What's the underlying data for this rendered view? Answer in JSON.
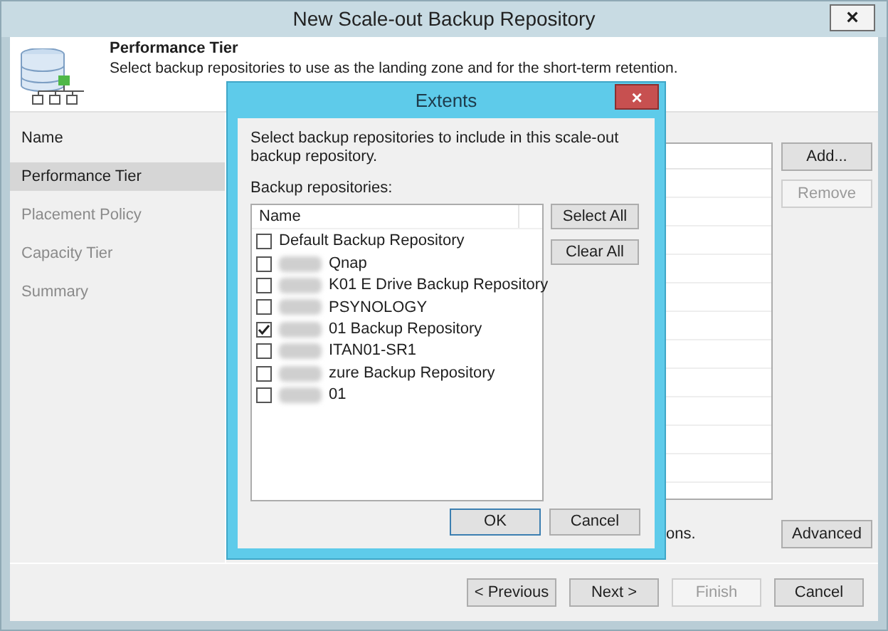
{
  "window": {
    "title": "New Scale-out Backup Repository",
    "close": "×"
  },
  "header": {
    "title": "Performance Tier",
    "subtitle": "Select backup repositories to use as the landing zone and for the short-term retention."
  },
  "steps": [
    {
      "label": "Name",
      "selected": false,
      "disabled": false
    },
    {
      "label": "Performance Tier",
      "selected": true,
      "disabled": false
    },
    {
      "label": "Placement Policy",
      "selected": false,
      "disabled": true
    },
    {
      "label": "Capacity Tier",
      "selected": false,
      "disabled": true
    },
    {
      "label": "Summary",
      "selected": false,
      "disabled": true
    }
  ],
  "side_buttons": [
    {
      "label": "Add...",
      "disabled": false
    },
    {
      "label": "Remove",
      "disabled": true
    }
  ],
  "hint_fragment": "ons.",
  "advanced_button": "Advanced",
  "footer_buttons": [
    {
      "label": "< Previous",
      "disabled": false
    },
    {
      "label": "Next >",
      "disabled": false
    },
    {
      "label": "Finish",
      "disabled": true
    },
    {
      "label": "Cancel",
      "disabled": false
    }
  ],
  "dialog": {
    "title": "Extents",
    "close": "×",
    "instruction": "Select backup repositories to include in this scale-out backup repository.",
    "list_label": "Backup repositories:",
    "column": "Name",
    "items": [
      {
        "label": "Default Backup Repository",
        "checked": false,
        "redacted": false
      },
      {
        "label": "Qnap",
        "checked": false,
        "redacted": true
      },
      {
        "label": "K01 E Drive Backup Repository",
        "checked": false,
        "redacted": true
      },
      {
        "label": "PSYNOLOGY",
        "checked": false,
        "redacted": true
      },
      {
        "label": "01 Backup Repository",
        "checked": true,
        "redacted": true
      },
      {
        "label": "ITAN01-SR1",
        "checked": false,
        "redacted": true
      },
      {
        "label": "zure Backup Repository",
        "checked": false,
        "redacted": true
      },
      {
        "label": "01",
        "checked": false,
        "redacted": true
      }
    ],
    "side_buttons": [
      "Select All",
      "Clear All"
    ],
    "ok": "OK",
    "cancel": "Cancel"
  }
}
